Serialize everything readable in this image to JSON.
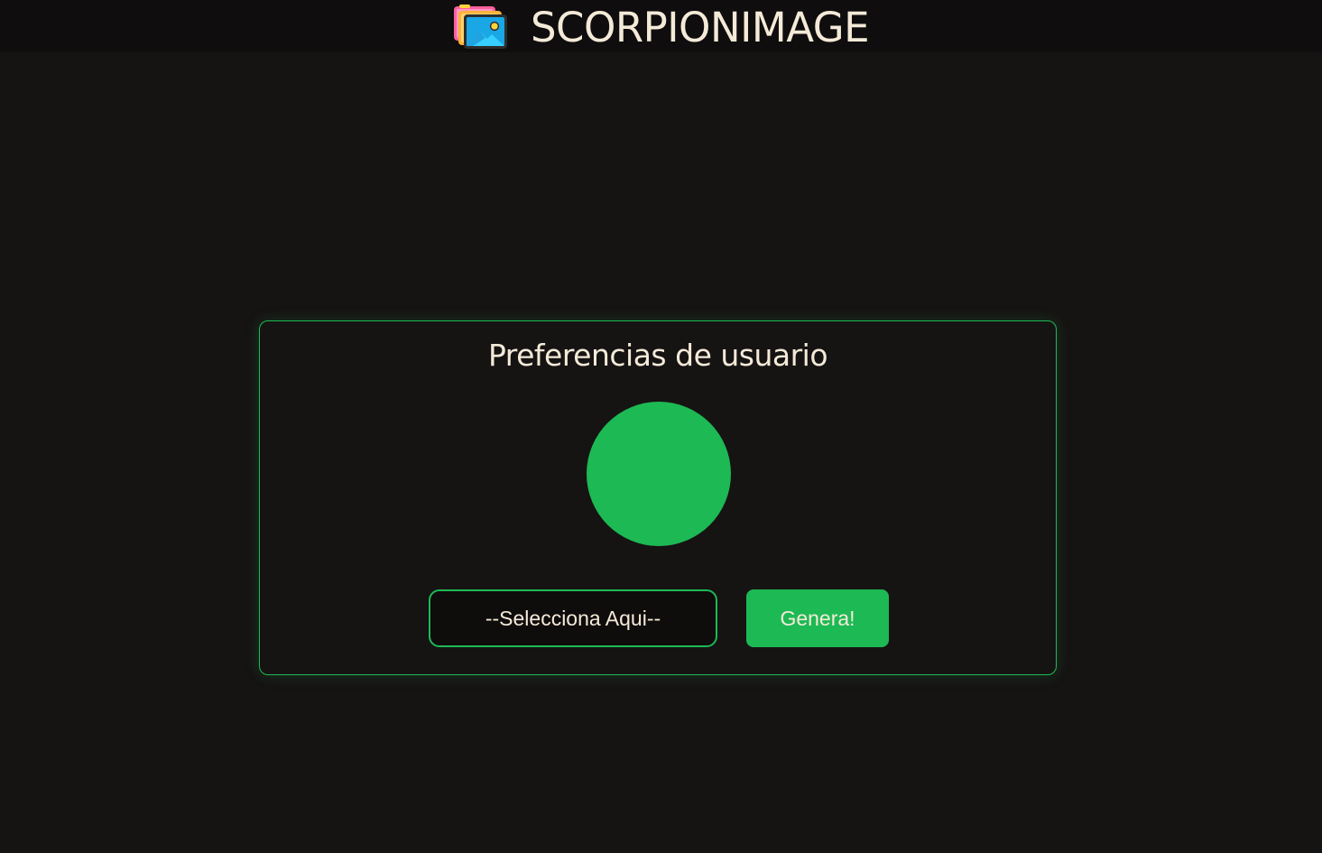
{
  "header": {
    "title": "SCORPIONIMAGE",
    "logo_icon": "image-gallery-icon"
  },
  "panel": {
    "title": "Preferencias de usuario",
    "preview_color": "#1db954",
    "select": {
      "selected_label": "--Selecciona Aqui--"
    },
    "generate_label": "Genera!"
  },
  "colors": {
    "background": "#161313",
    "topbar": "#0f0d0d",
    "accent": "#1db954",
    "text": "#f4ead8"
  }
}
